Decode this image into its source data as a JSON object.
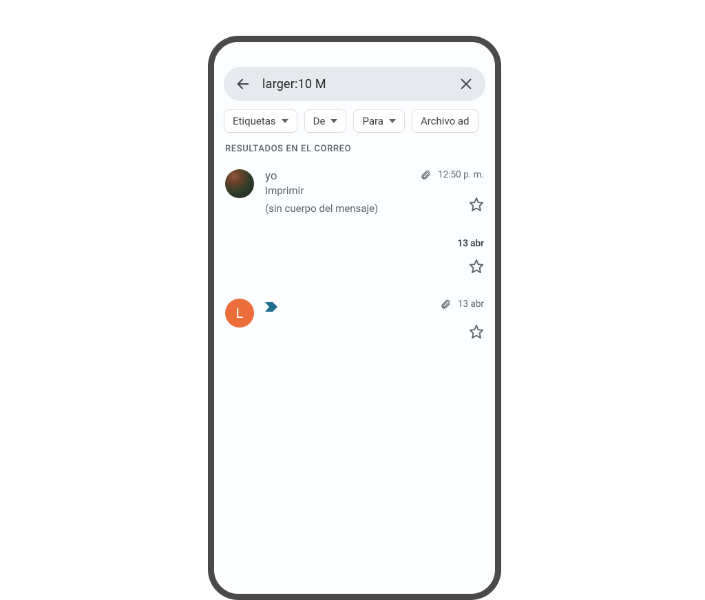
{
  "search": {
    "query": "larger:10 M"
  },
  "chips": [
    {
      "label": "Etiquetas"
    },
    {
      "label": "De"
    },
    {
      "label": "Para"
    },
    {
      "label": "Archivo ad"
    }
  ],
  "section_label": "RESULTADOS EN EL CORREO",
  "emails": [
    {
      "avatar_letter": "",
      "sender": "yo",
      "subject": "Imprimir",
      "snippet": "(sin cuerpo del mensaje)",
      "date": "12:50 p. m.",
      "has_attachment": true
    },
    {
      "avatar_letter": "",
      "sender": "",
      "subject": "",
      "snippet": "",
      "date": "13 abr",
      "has_attachment": false
    },
    {
      "avatar_letter": "L",
      "sender": "",
      "subject": "",
      "snippet": "",
      "date": "13 abr",
      "has_attachment": true
    }
  ]
}
